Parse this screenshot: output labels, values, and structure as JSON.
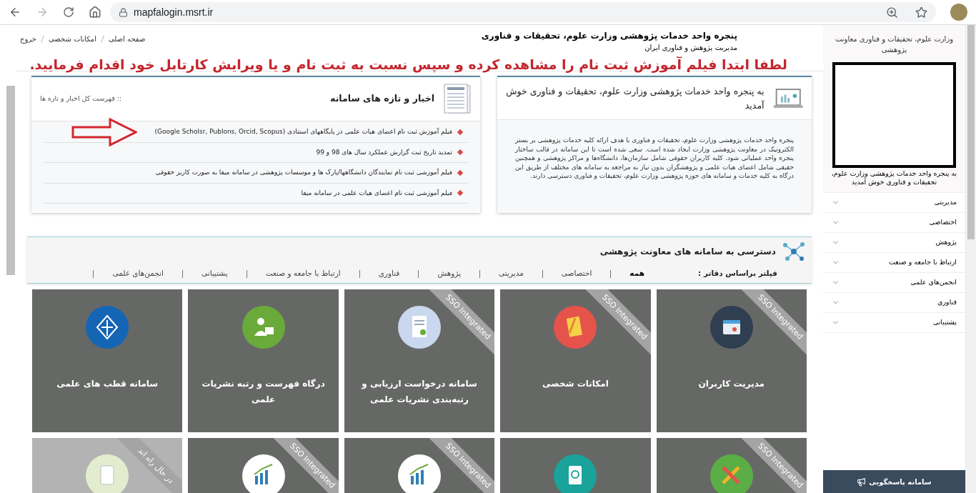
{
  "browser": {
    "url": "mapfalogin.msrt.ir"
  },
  "header": {
    "breadcrumbs": [
      "صفحه اصلی",
      "امکانات شخصی",
      "خروج"
    ],
    "title": "پنجره واحد خدمات پژوهشی وزارت علوم، تحقیقات و فناوری",
    "subtitle": "مدیریت پژوهش و فناوری ایران",
    "notice": "لطفا ابتدا فیلم آموزش ثبت نام را مشاهده کرده و سپس نسبت به ثبت نام و یا ویرایش کارتابل خود اقدام فرمایید."
  },
  "sidebar": {
    "title": "وزارت علوم، تحقیقات و فناوری معاونت پژوهشی",
    "caption": "به پنجره واحد خدمات پژوهشی وزارت علوم، تحقیقات و فناوری خوش آمدید",
    "menu": [
      {
        "label": "مدیریتی",
        "expanded": false
      },
      {
        "label": "اختصاصی",
        "expanded": false
      },
      {
        "label": "پژوهش",
        "expanded": false
      },
      {
        "label": "ارتباط با جامعه و صنعت",
        "expanded": false
      },
      {
        "label": "انجمن‌های علمی",
        "expanded": false
      },
      {
        "label": "فناوری",
        "expanded": false
      },
      {
        "label": "پشتیبانی",
        "expanded": false
      }
    ],
    "support_button": "سامانه پاسخگویی"
  },
  "welcome_card": {
    "title": "به پنجره واحد خدمات پژوهشی وزارت علوم، تحقیقات و فناوری خوش آمدید",
    "body": "پنجره واحد خدمات پژوهشی وزارت علوم، تحقیقات و فناوری با هدف ارائه کلیه خدمات پژوهشی بر بستر الکترونیک در معاونت پژوهشی وزارت ایجاد شده است. سعی شده است تا این سامانه در قالب ساختار پنجره واحد عملیاتی شود. کلیه کاربران حقوقی شامل سازمان‌ها، دانشگاه‌ها و مراکز پژوهشی و همچنین حقیقی شامل اعضای هیات علمی و پژوهشگران بدون نیاز به مراجعه به سامانه های مختلف از طریق این درگاه به کلیه خدمات و سامانه های حوزه پژوهشی وزارت علوم، تحقیقات و فناوری دسترسی دارند."
  },
  "news_card": {
    "title": "اخبار و تازه های سامانه",
    "all_link": ":: فهرست کل اخبار و تازه ها",
    "items": [
      "فیلم آموزش ثبت نام اعضای هیات علمی در پایگاههای استنادی (Google Scholsr, Publons, Orcid, Scopus)",
      "تمدید تاریخ ثبت گزارش عملکرد سال های 98 و 99",
      "فیلم آموزشی ثبت نام نمایندگان دانشگاهها/پارک ها و موسسات پژوهشی در سامانه میفا به صورت کاربر حقوقی",
      "فیلم آموزشی ثبت نام اعضای هیات علمی در سامانه میفا"
    ]
  },
  "systems": {
    "title": "دسترسی به سامانه های معاونت پژوهشی",
    "filter_label": "فیلتر براساس دفاتر :",
    "filters": [
      {
        "label": "همه",
        "selected": true
      },
      {
        "label": "اختصاصی",
        "selected": false
      },
      {
        "label": "مدیریتی",
        "selected": false
      },
      {
        "label": "پژوهش",
        "selected": false
      },
      {
        "label": "فناوری",
        "selected": false
      },
      {
        "label": "ارتباط با جامعه و صنعت",
        "selected": false
      },
      {
        "label": "پشتیبانی",
        "selected": false
      },
      {
        "label": "انجمن‌های علمی",
        "selected": false
      }
    ],
    "tiles": [
      {
        "label": "مدیریت کاربران",
        "ribbon": "SSO Integrated",
        "dimmed": false
      },
      {
        "label": "امکانات شخصی",
        "ribbon": "SSO Integrated",
        "dimmed": false
      },
      {
        "label": "سامانه درخواست ارزیابی و رتبه‌بندی نشریات علمی",
        "ribbon": "SSO Integrated",
        "dimmed": false
      },
      {
        "label": "درگاه فهرست و رتبه نشریات علمی",
        "dimmed": false
      },
      {
        "label": "سامانه قطب های علمی",
        "dimmed": false
      },
      {
        "ribbon": "SSO Integrated",
        "dimmed": false
      },
      {
        "dimmed": false
      },
      {
        "ribbon": "SSO Integrated",
        "dimmed": false
      },
      {
        "ribbon": "SSO Integrated",
        "dimmed": false
      },
      {
        "ribbon": "در حال راه اند",
        "dimmed": true
      }
    ]
  }
}
